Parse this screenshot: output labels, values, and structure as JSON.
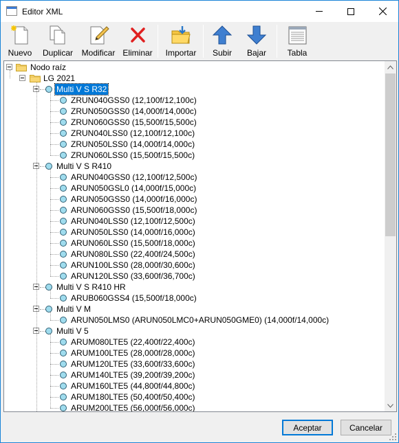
{
  "window": {
    "title": "Editor XML"
  },
  "toolbar": {
    "items": [
      {
        "label": "Nuevo",
        "icon": "new-document-icon"
      },
      {
        "label": "Duplicar",
        "icon": "duplicate-icon"
      },
      {
        "label": "Modificar",
        "icon": "edit-pencil-icon"
      },
      {
        "label": "Eliminar",
        "icon": "delete-x-icon"
      },
      {
        "label": "Importar",
        "icon": "import-folder-icon"
      },
      {
        "label": "Subir",
        "icon": "arrow-up-icon"
      },
      {
        "label": "Bajar",
        "icon": "arrow-down-icon"
      },
      {
        "label": "Tabla",
        "icon": "table-icon"
      }
    ]
  },
  "tree": {
    "root": "Nodo raíz",
    "brand": "LG 2021",
    "groups": [
      {
        "label": "Multi V S R32",
        "selected": true,
        "items": [
          "ZRUN040GSS0 (12,100f/12,100c)",
          "ZRUN050GSS0 (14,000f/14,000c)",
          "ZRUN060GSS0 (15,500f/15,500c)",
          "ZRUN040LSS0 (12,100f/12,100c)",
          "ZRUN050LSS0 (14,000f/14,000c)",
          "ZRUN060LSS0 (15,500f/15,500c)"
        ]
      },
      {
        "label": "Multi V S R410",
        "selected": false,
        "items": [
          "ARUN040GSS0 (12,100f/12,500c)",
          "ARUN050GSL0 (14,000f/15,000c)",
          "ARUN050GSS0 (14,000f/16,000c)",
          "ARUN060GSS0 (15,500f/18,000c)",
          "ARUN040LSS0 (12,100f/12,500c)",
          "ARUN050LSS0 (14,000f/16,000c)",
          "ARUN060LSS0 (15,500f/18,000c)",
          "ARUN080LSS0 (22,400f/24,500c)",
          "ARUN100LSS0 (28,000f/30,600c)",
          "ARUN120LSS0 (33,600f/36,700c)"
        ]
      },
      {
        "label": "Multi V S R410 HR",
        "selected": false,
        "items": [
          "ARUB060GSS4 (15,500f/18,000c)"
        ]
      },
      {
        "label": "Multi V M",
        "selected": false,
        "items": [
          "ARUN050LMS0 (ARUN050LMC0+ARUN050GME0) (14,000f/14,000c)"
        ]
      },
      {
        "label": "Multi V 5",
        "selected": false,
        "items": [
          "ARUM080LTE5 (22,400f/22,400c)",
          "ARUM100LTE5 (28,000f/28,000c)",
          "ARUM120LTE5 (33,600f/33,600c)",
          "ARUM140LTE5 (39,200f/39,200c)",
          "ARUM160LTE5 (44,800f/44,800c)",
          "ARUM180LTE5 (50,400f/50,400c)",
          "ARUM200LTE5 (56,000f/56,000c)"
        ]
      }
    ]
  },
  "footer": {
    "accept_label": "Aceptar",
    "cancel_label": "Cancelar"
  },
  "colors": {
    "selection": "#0078d7",
    "node_circle": "#9fdcee",
    "accent_border": "#1883d7"
  }
}
